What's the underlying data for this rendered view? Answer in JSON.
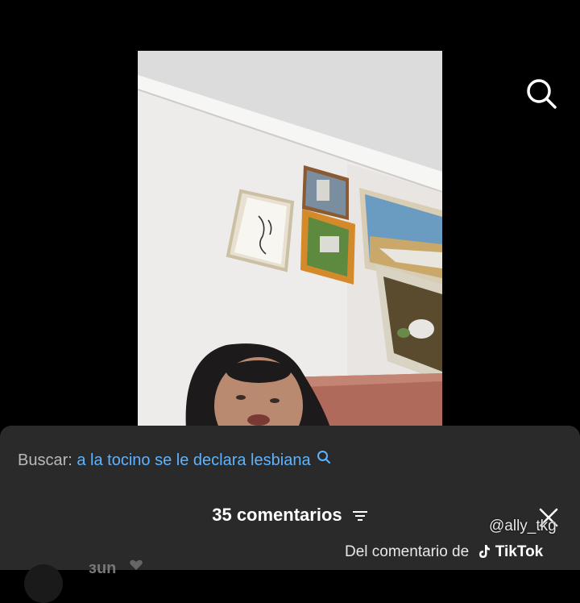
{
  "video": {
    "description_icon": "video-frame"
  },
  "toolbar": {
    "search_icon": "search-icon"
  },
  "comments_sheet": {
    "search_label": "Buscar:",
    "search_query": "a la tocino se le declara lesbiana",
    "count_label": "35 comentarios",
    "partial_username": "зun"
  },
  "watermark": {
    "handle": "@ally_tkg",
    "source_prefix": "Del comentario de",
    "brand": "TikTok"
  },
  "colors": {
    "background": "#000000",
    "sheet": "#2a2a2a",
    "link_blue": "#5eb3ff"
  }
}
